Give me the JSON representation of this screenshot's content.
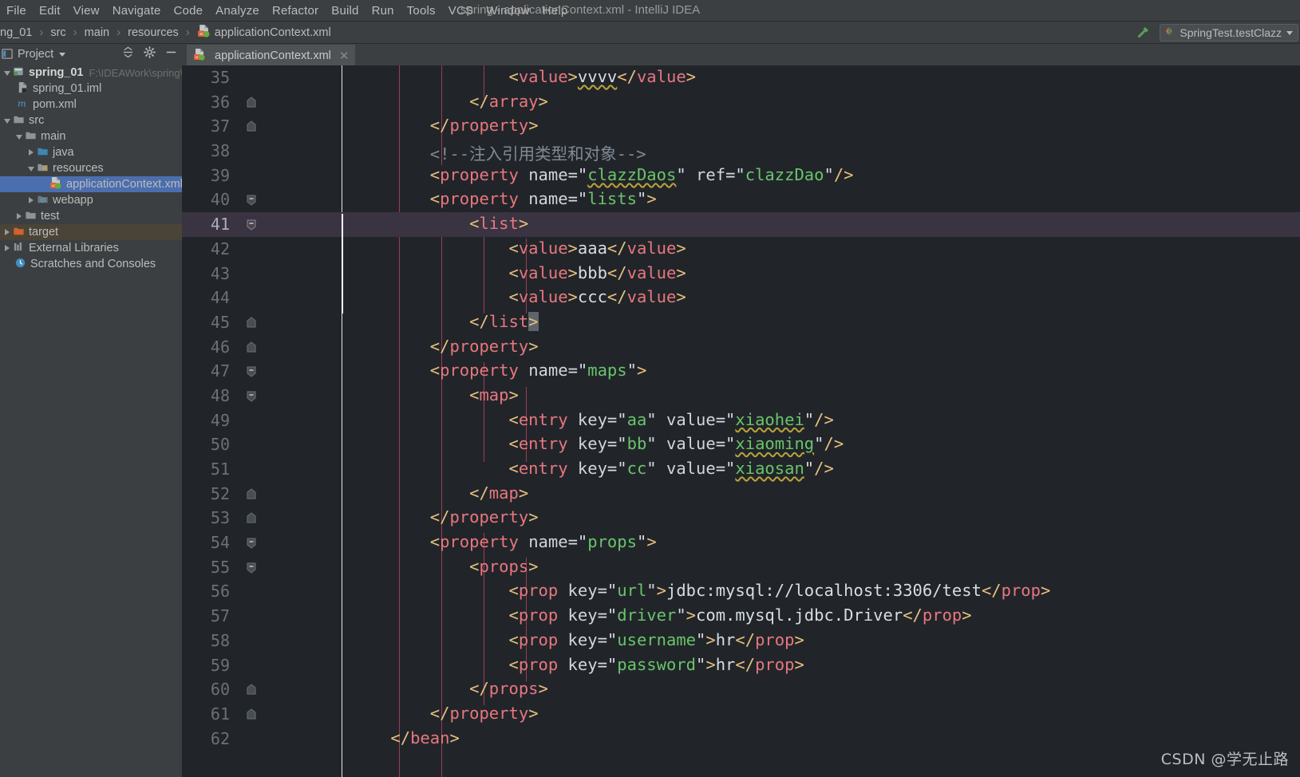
{
  "window": {
    "title": "spring - applicationContext.xml - IntelliJ IDEA"
  },
  "menubar": {
    "items": [
      {
        "label": "File"
      },
      {
        "label": "Edit"
      },
      {
        "label": "View"
      },
      {
        "label": "Navigate"
      },
      {
        "label": "Code"
      },
      {
        "label": "Analyze"
      },
      {
        "label": "Refactor"
      },
      {
        "label": "Build"
      },
      {
        "label": "Run"
      },
      {
        "label": "Tools"
      },
      {
        "label": "VCS"
      },
      {
        "label": "Window"
      },
      {
        "label": "Help"
      }
    ]
  },
  "breadcrumb": {
    "items": [
      "ng_01",
      "src",
      "main",
      "resources",
      "applicationContext.xml"
    ],
    "separator": "›"
  },
  "toolbar_right": {
    "build_icon": "hammer-icon",
    "run_config": "SpringTest.testClazz",
    "dropdown_icon": "chevron-down-icon"
  },
  "project_panel": {
    "title": "Project",
    "collapse_all_icon": "collapse-all-icon",
    "settings_icon": "gear-icon",
    "hide_icon": "minimize-icon",
    "tree": [
      {
        "label": "spring_01",
        "hint": "F:\\IDEAWork\\spring\\spring_",
        "indent": 0,
        "twisty": "down",
        "icon": "module-icon",
        "bold": true,
        "state": "normal"
      },
      {
        "label": "spring_01.iml",
        "hint": "",
        "indent": 1,
        "twisty": "none",
        "icon": "iml-icon",
        "bold": false,
        "state": "normal"
      },
      {
        "label": "pom.xml",
        "hint": "",
        "indent": 1,
        "twisty": "none",
        "icon": "maven-icon",
        "bold": false,
        "state": "normal"
      },
      {
        "label": "src",
        "hint": "",
        "indent": 1,
        "twisty": "down",
        "icon": "folder-icon",
        "bold": false,
        "state": "normal"
      },
      {
        "label": "main",
        "hint": "",
        "indent": 2,
        "twisty": "down",
        "icon": "folder-icon",
        "bold": false,
        "state": "normal"
      },
      {
        "label": "java",
        "hint": "",
        "indent": 3,
        "twisty": "right",
        "icon": "source-folder-icon",
        "bold": false,
        "state": "normal"
      },
      {
        "label": "resources",
        "hint": "",
        "indent": 3,
        "twisty": "down",
        "icon": "resources-folder-icon",
        "bold": false,
        "state": "normal"
      },
      {
        "label": "applicationContext.xml",
        "hint": "",
        "indent": 4,
        "twisty": "none",
        "icon": "spring-xml-icon",
        "bold": false,
        "state": "selected"
      },
      {
        "label": "webapp",
        "hint": "",
        "indent": 3,
        "twisty": "right",
        "icon": "webapp-folder-icon",
        "bold": false,
        "state": "normal"
      },
      {
        "label": "test",
        "hint": "",
        "indent": 2,
        "twisty": "right",
        "icon": "folder-icon",
        "bold": false,
        "state": "normal"
      },
      {
        "label": "target",
        "hint": "",
        "indent": 1,
        "twisty": "right",
        "icon": "excluded-folder-icon",
        "bold": false,
        "state": "target"
      },
      {
        "label": "External Libraries",
        "hint": "",
        "indent": 0,
        "twisty": "right",
        "icon": "libraries-icon",
        "bold": false,
        "state": "normal"
      },
      {
        "label": "Scratches and Consoles",
        "hint": "",
        "indent": 0,
        "twisty": "none",
        "icon": "scratches-icon",
        "bold": false,
        "state": "normal"
      }
    ]
  },
  "editor_tabs": [
    {
      "label": "applicationContext.xml",
      "icon": "spring-xml-icon",
      "close_icon": "close-icon",
      "active": true
    }
  ],
  "editor": {
    "first_line_number": 35,
    "current_line_number": 41,
    "lines": [
      {
        "n": 35,
        "fold": "none",
        "text": "                <value>vvvv</value>"
      },
      {
        "n": 36,
        "fold": "end",
        "text": "            </array>"
      },
      {
        "n": 37,
        "fold": "end",
        "text": "        </property>"
      },
      {
        "n": 38,
        "fold": "none",
        "text": "        <!--注入引用类型和对象-->"
      },
      {
        "n": 39,
        "fold": "none",
        "text": "        <property name=\"clazzDaos\" ref=\"clazzDao\"/>"
      },
      {
        "n": 40,
        "fold": "start",
        "text": "        <property name=\"lists\">"
      },
      {
        "n": 41,
        "fold": "start",
        "text": "            <list>"
      },
      {
        "n": 42,
        "fold": "none",
        "text": "                <value>aaa</value>"
      },
      {
        "n": 43,
        "fold": "none",
        "text": "                <value>bbb</value>"
      },
      {
        "n": 44,
        "fold": "none",
        "text": "                <value>ccc</value>"
      },
      {
        "n": 45,
        "fold": "end",
        "text": "            </list>"
      },
      {
        "n": 46,
        "fold": "end",
        "text": "        </property>"
      },
      {
        "n": 47,
        "fold": "start",
        "text": "        <property name=\"maps\">"
      },
      {
        "n": 48,
        "fold": "start",
        "text": "            <map>"
      },
      {
        "n": 49,
        "fold": "none",
        "text": "                <entry key=\"aa\" value=\"xiaohei\"/>"
      },
      {
        "n": 50,
        "fold": "none",
        "text": "                <entry key=\"bb\" value=\"xiaoming\"/>"
      },
      {
        "n": 51,
        "fold": "none",
        "text": "                <entry key=\"cc\" value=\"xiaosan\"/>"
      },
      {
        "n": 52,
        "fold": "end",
        "text": "            </map>"
      },
      {
        "n": 53,
        "fold": "end",
        "text": "        </property>"
      },
      {
        "n": 54,
        "fold": "start",
        "text": "        <property name=\"props\">"
      },
      {
        "n": 55,
        "fold": "start",
        "text": "            <props>"
      },
      {
        "n": 56,
        "fold": "none",
        "text": "                <prop key=\"url\">jdbc:mysql://localhost:3306/test</prop>"
      },
      {
        "n": 57,
        "fold": "none",
        "text": "                <prop key=\"driver\">com.mysql.jdbc.Driver</prop>"
      },
      {
        "n": 58,
        "fold": "none",
        "text": "                <prop key=\"username\">hr</prop>"
      },
      {
        "n": 59,
        "fold": "none",
        "text": "                <prop key=\"password\">hr</prop>"
      },
      {
        "n": 60,
        "fold": "end",
        "text": "            </props>"
      },
      {
        "n": 61,
        "fold": "end",
        "text": "        </property>"
      },
      {
        "n": 62,
        "fold": "none",
        "text": "    </bean>"
      }
    ]
  },
  "watermark": {
    "text": "CSDN @学无止路"
  },
  "colors": {
    "chrome_bg": "#3c3f41",
    "editor_bg": "#21252a",
    "selection_blue": "#4b6eaf",
    "current_line": "#3a3442",
    "tag_pink": "#e8777e",
    "bracket_yellow": "#e8c07d",
    "attr_value_green": "#6ac46a",
    "comment_gray": "#808a94",
    "text_gray": "#d6dde3",
    "target_row": "#4a4438"
  }
}
